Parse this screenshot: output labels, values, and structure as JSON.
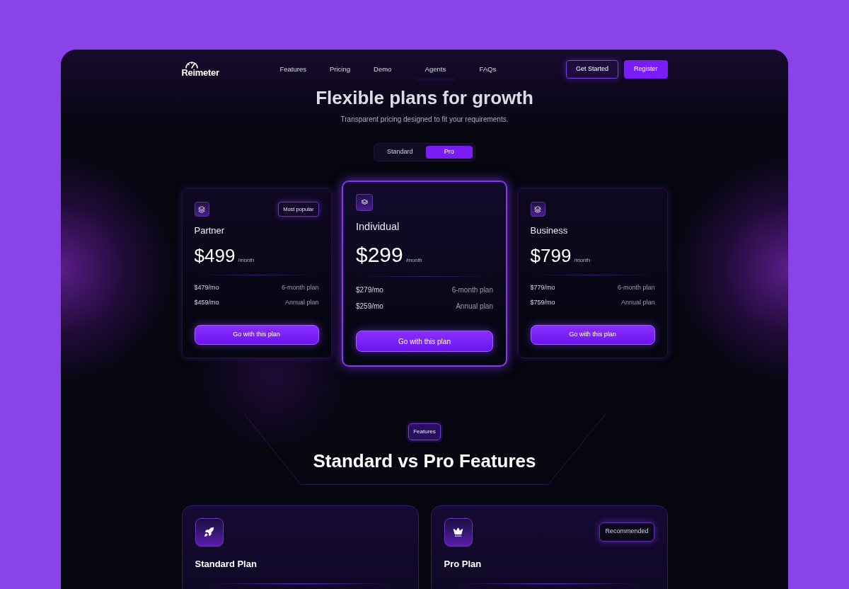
{
  "nav": {
    "logo": "Reimeter",
    "links": [
      {
        "label": "Features",
        "selected": false
      },
      {
        "label": "Pricing",
        "selected": false
      },
      {
        "label": "Demo",
        "selected": false
      },
      {
        "label": "Agents",
        "selected": true
      },
      {
        "label": "FAQs",
        "selected": false
      }
    ],
    "buttons": [
      {
        "label": "Get Started",
        "kind": "outline"
      },
      {
        "label": "Register",
        "kind": "solid"
      }
    ]
  },
  "hero": {
    "title": "Flexible plans for growth",
    "subtitle": "Transparent pricing designed to fit your requirements."
  },
  "billing_toggle": [
    {
      "label": "Standard",
      "selected": false
    },
    {
      "label": "Pro",
      "selected": true
    }
  ],
  "plans": [
    {
      "name": "Partner",
      "badge": "Most popular",
      "featured": false,
      "price": "$499",
      "period": "/month",
      "options": [
        {
          "price": "$479/mo",
          "term": "6-month plan"
        },
        {
          "price": "$459/mo",
          "term": "Annual plan"
        }
      ],
      "button": "Go with this plan"
    },
    {
      "name": "Individual",
      "featured": true,
      "price": "$299",
      "period": "/month",
      "options": [
        {
          "price": "$279/mo",
          "term": "6-month plan"
        },
        {
          "price": "$259/mo",
          "term": "Annual plan"
        }
      ],
      "button": "Go with this plan"
    },
    {
      "name": "Business",
      "featured": false,
      "price": "$799",
      "period": "/month",
      "options": [
        {
          "price": "$779/mo",
          "term": "6-month plan"
        },
        {
          "price": "$759/mo",
          "term": "Annual plan"
        }
      ],
      "button": "Go with this plan"
    }
  ],
  "features_section": {
    "badge": "Features",
    "title": "Standard vs Pro Features"
  },
  "comparison_cards": [
    {
      "title": "Standard Plan"
    },
    {
      "title": "Pro Plan",
      "badge": "Recommended"
    }
  ]
}
